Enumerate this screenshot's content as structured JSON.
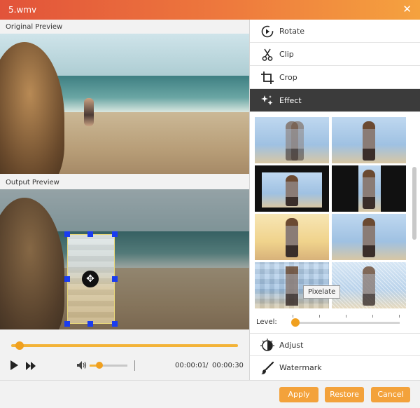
{
  "window": {
    "title": "5.wmv",
    "close_label": "✕"
  },
  "left": {
    "original_label": "Original Preview",
    "output_label": "Output Preview"
  },
  "player": {
    "current_time": "00:00:01",
    "time_separator": "/",
    "total_time": "00:00:30",
    "progress": 0.02,
    "volume": 0.25
  },
  "menu": [
    {
      "label": "Rotate",
      "icon": "rotate-icon",
      "active": false
    },
    {
      "label": "Clip",
      "icon": "scissors-icon",
      "active": false
    },
    {
      "label": "Crop",
      "icon": "crop-icon",
      "active": false
    },
    {
      "label": "Effect",
      "icon": "sparkle-icon",
      "active": true
    }
  ],
  "effects": {
    "selected": "Pixelate",
    "tooltip": "Pixelate",
    "level_label": "Level:",
    "level": 0
  },
  "bottom_menu": [
    {
      "label": "Adjust",
      "icon": "adjust-icon"
    },
    {
      "label": "Watermark",
      "icon": "brush-icon"
    }
  ],
  "footer": {
    "apply_label": "Apply",
    "restore_label": "Restore",
    "cancel_label": "Cancel"
  },
  "colors": {
    "accent": "#f3a23b",
    "title_gradient_start": "#e2533a",
    "title_gradient_end": "#f5a23f",
    "selection": "#d9443a",
    "crop_handle": "#1a3cf0"
  }
}
